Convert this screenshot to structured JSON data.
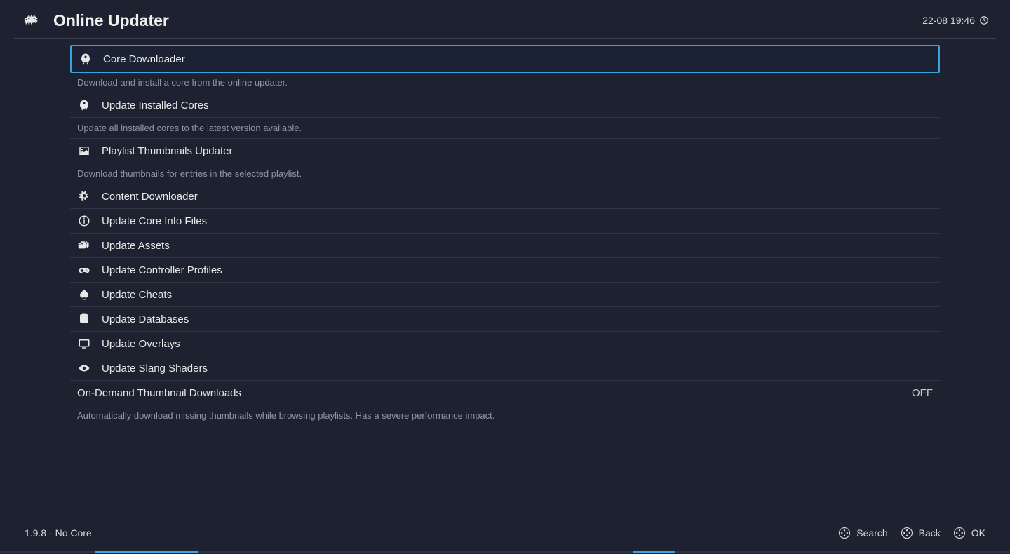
{
  "header": {
    "title": "Online Updater",
    "datetime": "22-08 19:46"
  },
  "menu": [
    {
      "icon": "rocket",
      "label": "Core Downloader",
      "selected": true,
      "desc": "Download and install a core from the online updater."
    },
    {
      "icon": "rocket",
      "label": "Update Installed Cores",
      "desc": "Update all installed cores to the latest version available."
    },
    {
      "icon": "image",
      "label": "Playlist Thumbnails Updater",
      "desc": "Download thumbnails for entries in the selected playlist."
    },
    {
      "icon": "gears",
      "label": "Content Downloader"
    },
    {
      "icon": "info",
      "label": "Update Core Info Files"
    },
    {
      "icon": "invader",
      "label": "Update Assets"
    },
    {
      "icon": "controller",
      "label": "Update Controller Profiles"
    },
    {
      "icon": "spade",
      "label": "Update Cheats"
    },
    {
      "icon": "database",
      "label": "Update Databases"
    },
    {
      "icon": "overlay",
      "label": "Update Overlays"
    },
    {
      "icon": "eye",
      "label": "Update Slang Shaders"
    },
    {
      "icon": "",
      "label": "On-Demand Thumbnail Downloads",
      "value": "OFF",
      "desc": "Automatically download missing thumbnails while browsing playlists. Has a severe performance impact."
    }
  ],
  "footer": {
    "version": "1.9.8 - No Core",
    "buttons": [
      {
        "label": "Search"
      },
      {
        "label": "Back"
      },
      {
        "label": "OK"
      }
    ]
  }
}
